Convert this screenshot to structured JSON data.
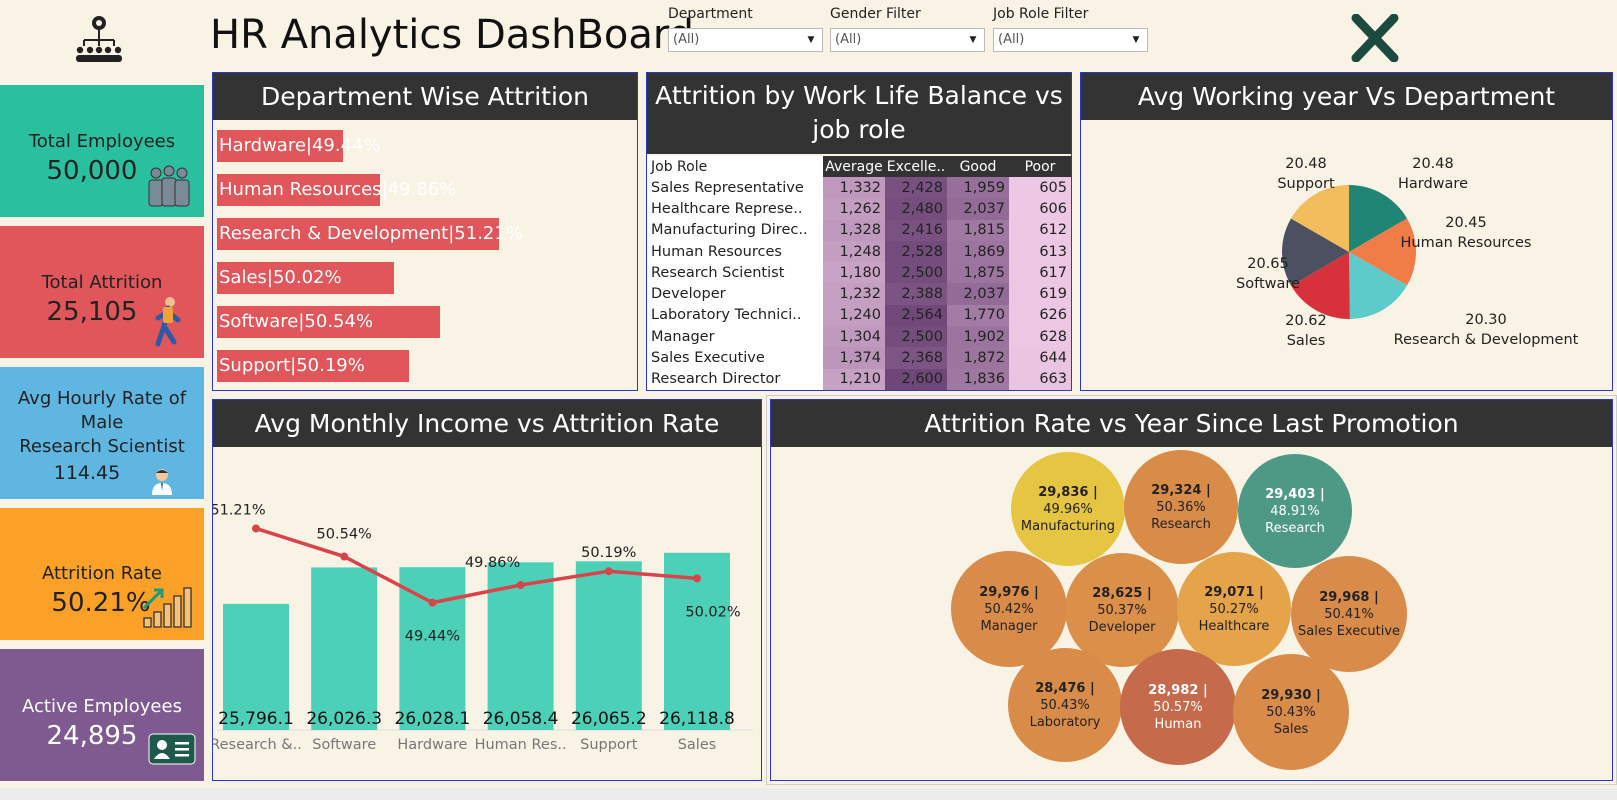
{
  "header": {
    "title": "HR Analytics DashBoard"
  },
  "filters": [
    {
      "label": "Department",
      "value": "(All)"
    },
    {
      "label": "Gender Filter",
      "value": "(All)"
    },
    {
      "label": "Job Role Filter",
      "value": "(All)"
    }
  ],
  "colors": {
    "teal": "#2abf9f",
    "red": "#e1565b",
    "blue": "#5fb6e0",
    "orange": "#fca127",
    "purple": "#7f5a91",
    "bar": "#e1565b",
    "dark": "#333333"
  },
  "kpis": {
    "total_employees": {
      "label": "Total Employees",
      "value": "50,000"
    },
    "total_attrition": {
      "label": "Total Attrition",
      "value": "25,105"
    },
    "avg_hourly": {
      "label_lines": [
        "Avg Hourly Rate of",
        "Male",
        "Research Scientist"
      ],
      "value": "114.45"
    },
    "attrition_rate": {
      "label": "Attrition Rate",
      "value": "50.21%"
    },
    "active_employees": {
      "label": "Active Employees",
      "value": "24,895"
    }
  },
  "panels": {
    "dept_attrition": "Department Wise Attrition",
    "wlb": [
      "Attrition by Work Life Balance vs",
      "job role"
    ],
    "avg_working": "Avg Working year Vs Department",
    "income": "Avg Monthly Income vs Attrition Rate",
    "promotion": "Attrition Rate vs Year Since Last Promotion"
  },
  "chart_data": [
    {
      "type": "bar",
      "title": "Department Wise Attrition",
      "categories": [
        "Hardware",
        "Human Resources",
        "Research & Development",
        "Sales",
        "Software",
        "Support"
      ],
      "values": [
        49.44,
        49.86,
        51.21,
        50.02,
        50.54,
        50.19
      ],
      "labels": [
        "Hardware|49.44%",
        "Human Resources|49.86%",
        "Research & Development|51.21%",
        "Sales|50.02%",
        "Software|50.54%",
        "Support|50.19%"
      ]
    },
    {
      "type": "heatmap",
      "title": "Attrition by Work Life Balance vs job role",
      "columns": [
        "Job Role",
        "Average",
        "Excelle..",
        "Good",
        "Poor"
      ],
      "rows": [
        {
          "role": "Sales Representative",
          "values": [
            1332,
            2428,
            1959,
            605
          ],
          "display": [
            "1,332",
            "2,428",
            "1,959",
            "605"
          ]
        },
        {
          "role": "Healthcare Represe..",
          "values": [
            1262,
            2480,
            2037,
            606
          ],
          "display": [
            "1,262",
            "2,480",
            "2,037",
            "606"
          ]
        },
        {
          "role": "Manufacturing Direc..",
          "values": [
            1328,
            2416,
            1815,
            612
          ],
          "display": [
            "1,328",
            "2,416",
            "1,815",
            "612"
          ]
        },
        {
          "role": "Human Resources",
          "values": [
            1248,
            2528,
            1869,
            613
          ],
          "display": [
            "1,248",
            "2,528",
            "1,869",
            "613"
          ]
        },
        {
          "role": "Research Scientist",
          "values": [
            1180,
            2500,
            1875,
            617
          ],
          "display": [
            "1,180",
            "2,500",
            "1,875",
            "617"
          ]
        },
        {
          "role": "Developer",
          "values": [
            1232,
            2388,
            2037,
            619
          ],
          "display": [
            "1,232",
            "2,388",
            "2,037",
            "619"
          ]
        },
        {
          "role": "Laboratory Technici..",
          "values": [
            1240,
            2564,
            1770,
            626
          ],
          "display": [
            "1,240",
            "2,564",
            "1,770",
            "626"
          ]
        },
        {
          "role": "Manager",
          "values": [
            1304,
            2500,
            1902,
            628
          ],
          "display": [
            "1,304",
            "2,500",
            "1,902",
            "628"
          ]
        },
        {
          "role": "Sales Executive",
          "values": [
            1374,
            2368,
            1872,
            644
          ],
          "display": [
            "1,374",
            "2,368",
            "1,872",
            "644"
          ]
        },
        {
          "role": "Research Director",
          "values": [
            1210,
            2600,
            1836,
            663
          ],
          "display": [
            "1,210",
            "2,600",
            "1,836",
            "663"
          ]
        }
      ]
    },
    {
      "type": "pie",
      "title": "Avg Working year Vs Department",
      "slices": [
        {
          "label": "Hardware",
          "value": 20.48,
          "display": "20.48",
          "color": "#208575"
        },
        {
          "label": "Human Resources",
          "value": 20.45,
          "display": "20.45",
          "color": "#f07c48"
        },
        {
          "label": "Research & Development",
          "value": 20.3,
          "display": "20.30",
          "color": "#5ccbc9"
        },
        {
          "label": "Sales",
          "value": 20.62,
          "display": "20.62",
          "color": "#d7323b"
        },
        {
          "label": "Software",
          "value": 20.65,
          "display": "20.65",
          "color": "#4c5061"
        },
        {
          "label": "Support",
          "value": 20.48,
          "display": "20.48",
          "color": "#f2bd5c"
        }
      ]
    },
    {
      "type": "bar",
      "title": "Avg Monthly Income vs Attrition Rate",
      "categories": [
        "Research &..",
        "Software",
        "Hardware",
        "Human Res..",
        "Support",
        "Sales"
      ],
      "series": [
        {
          "values": [
            25796.1,
            26026.3,
            26028.1,
            26058.4,
            26065.2,
            26118.8
          ],
          "display": [
            "25,796.1",
            "26,026.3",
            "26,028.1",
            "26,058.4",
            "26,065.2",
            "26,118.8"
          ],
          "color": "#4dd0b8"
        },
        {
          "values": [
            51.21,
            50.54,
            49.44,
            49.86,
            50.19,
            50.02
          ],
          "display": [
            "51.21%",
            "50.54%",
            "49.44%",
            "49.86%",
            "50.19%",
            "50.02%"
          ],
          "color": "#d9434a"
        }
      ]
    },
    {
      "type": "scatter",
      "title": "Attrition Rate vs Year Since Last Promotion",
      "bubbles": [
        {
          "name": "Manufacturing",
          "value": "29,836 |",
          "rate": "49.96%",
          "color": "#e6c543"
        },
        {
          "name": "Research",
          "value": "29,324 |",
          "rate": "50.36%",
          "color": "#d98c48"
        },
        {
          "name": "Research",
          "value": "29,403 |",
          "rate": "48.91%",
          "color": "#4e9985"
        },
        {
          "name": "Manager",
          "value": "29,976 |",
          "rate": "50.42%",
          "color": "#d98b4a"
        },
        {
          "name": "Developer",
          "value": "28,625 |",
          "rate": "50.37%",
          "color": "#db9049"
        },
        {
          "name": "Healthcare",
          "value": "29,071 |",
          "rate": "50.27%",
          "color": "#e5a44a"
        },
        {
          "name": "Sales Executive",
          "value": "29,968 |",
          "rate": "50.41%",
          "color": "#d98b4a"
        },
        {
          "name": "Laboratory",
          "value": "28,476 |",
          "rate": "50.43%",
          "color": "#d98b4a"
        },
        {
          "name": "Human",
          "value": "28,982 |",
          "rate": "50.57%",
          "color": "#c66a4c"
        },
        {
          "name": "Sales",
          "value": "29,930 |",
          "rate": "50.43%",
          "color": "#d98b4a"
        }
      ]
    }
  ]
}
